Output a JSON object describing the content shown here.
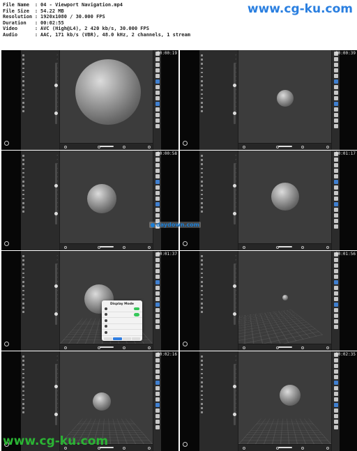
{
  "header": {
    "rows": [
      {
        "label": "File Name",
        "sep": ":",
        "value": "04 - Viewport Navigation.mp4"
      },
      {
        "label": "File Size",
        "sep": ":",
        "value": "54.22 MB"
      },
      {
        "label": "Resolution",
        "sep": ":",
        "value": "1920x1080 / 30.000 FPS"
      },
      {
        "label": "Duration",
        "sep": ":",
        "value": "00:02:55"
      },
      {
        "label": "Video",
        "sep": ":",
        "value": "AVC (High@L4), 2 420 kb/s, 30.000 FPS"
      },
      {
        "label": "Audio",
        "sep": ":",
        "value": "AAC, 171 kb/s (VBR), 48.0 kHz, 2 channels, 1 stream"
      }
    ]
  },
  "watermarks": {
    "top": "www.cg-ku.com",
    "bottom": "www.cg-ku.com",
    "middle": "daydown.com"
  },
  "colors": {
    "watermark_top": "#2a7fe0",
    "watermark_bottom": "#2bb534",
    "accent": "#3f7fd0",
    "toggle_on": "#35c759"
  },
  "frames": [
    {
      "timestamp": "00:00:19",
      "scene": "sphere-large"
    },
    {
      "timestamp": "00:00:39",
      "scene": "sphere-small"
    },
    {
      "timestamp": "00:00:58",
      "scene": "sphere-medium"
    },
    {
      "timestamp": "00:01:17",
      "scene": "sphere-medium-center"
    },
    {
      "timestamp": "00:01:37",
      "scene": "sphere-grid-popup"
    },
    {
      "timestamp": "00:01:56",
      "scene": "grid-tilted-small"
    },
    {
      "timestamp": "00:02:16",
      "scene": "sphere-grid"
    },
    {
      "timestamp": "00:02:35",
      "scene": "sphere-grid-right"
    }
  ],
  "popup": {
    "title": "Display Mode"
  },
  "icons": {
    "logo": "circle-logo-icon",
    "tool": "tool-icon",
    "menu_item": "menu-item-icon",
    "chevron": "chevron-right-icon",
    "toggle": "toggle-icon",
    "sphere": "sphere-shape",
    "grid": "floor-grid"
  }
}
